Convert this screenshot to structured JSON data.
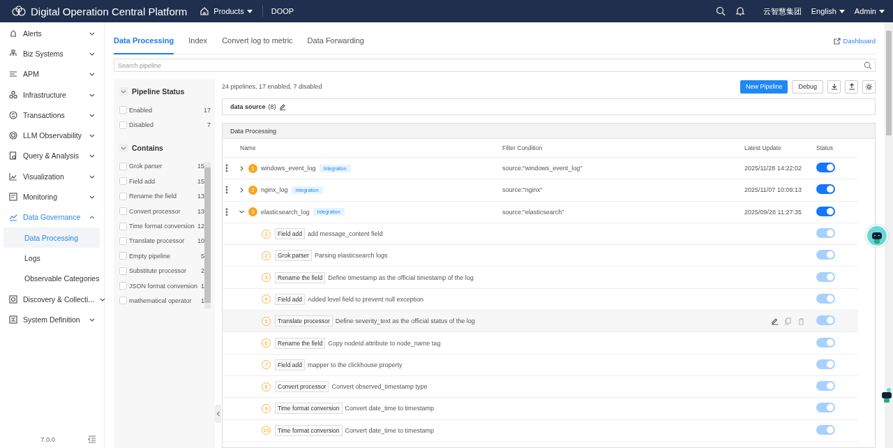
{
  "header": {
    "title": "Digital Operation Central Platform",
    "products": "Products",
    "app": "DOOP",
    "org": "云智慧集团",
    "language": "English",
    "user": "Admin"
  },
  "sidebar": {
    "items": [
      {
        "label": "Alerts",
        "expanded": false,
        "active": false
      },
      {
        "label": "Biz Systems",
        "expanded": false,
        "active": false
      },
      {
        "label": "APM",
        "expanded": false,
        "active": false
      },
      {
        "label": "Infrastructure",
        "expanded": false,
        "active": false
      },
      {
        "label": "Transactions",
        "expanded": false,
        "active": false
      },
      {
        "label": "LLM Observability",
        "expanded": false,
        "active": false
      },
      {
        "label": "Query & Analysis",
        "expanded": false,
        "active": false
      },
      {
        "label": "Visualization",
        "expanded": false,
        "active": false
      },
      {
        "label": "Monitoring",
        "expanded": false,
        "active": false
      },
      {
        "label": "Data Governance",
        "expanded": true,
        "active": true,
        "children": [
          {
            "label": "Data Processing",
            "selected": true
          },
          {
            "label": "Logs",
            "selected": false
          },
          {
            "label": "Observable Categories",
            "selected": false
          }
        ]
      },
      {
        "label": "Discovery & Collecti...",
        "expanded": false,
        "active": false
      },
      {
        "label": "System Definition",
        "expanded": false,
        "active": false
      }
    ],
    "version": "7.0.0"
  },
  "tabs": [
    {
      "label": "Data Processing",
      "selected": true
    },
    {
      "label": "Index",
      "selected": false
    },
    {
      "label": "Convert log to metric",
      "selected": false
    },
    {
      "label": "Data Forwarding",
      "selected": false
    }
  ],
  "dashboard_link": "Dashboard",
  "search": {
    "placeholder": "Search pipeline"
  },
  "filters": [
    {
      "title": "Pipeline Status",
      "expanded": true,
      "items": [
        {
          "label": "Enabled",
          "count": "17",
          "checked": false
        },
        {
          "label": "Disabled",
          "count": "7",
          "checked": false
        }
      ]
    },
    {
      "title": "Contains",
      "expanded": true,
      "items": [
        {
          "label": "Grok parser",
          "count": "15",
          "checked": false
        },
        {
          "label": "Field add",
          "count": "15",
          "checked": false
        },
        {
          "label": "Rename the field",
          "count": "13",
          "checked": false
        },
        {
          "label": "Convert processor",
          "count": "13",
          "checked": false
        },
        {
          "label": "Time format conversion",
          "count": "12",
          "checked": false
        },
        {
          "label": "Translate processor",
          "count": "10",
          "checked": false
        },
        {
          "label": "Empty pipeline",
          "count": "5",
          "checked": false
        },
        {
          "label": "Substitute processor",
          "count": "2",
          "checked": false
        },
        {
          "label": "JSON format conversion",
          "count": "1",
          "checked": false
        },
        {
          "label": "mathematical operator",
          "count": "1",
          "checked": false
        }
      ]
    }
  ],
  "summary": "24 pipelines, 17 enabled, 7 disabled",
  "buttons": {
    "new": "New Pipeline",
    "debug": "Debug"
  },
  "data_source": {
    "label": "data source",
    "count": "(8)"
  },
  "panel_title": "Data Processing",
  "table": {
    "columns": [
      "Name",
      "Filter Condition",
      "Latest Update",
      "Status"
    ],
    "rows": [
      {
        "number": "1",
        "name": "windows_event_log",
        "tag": "Integration",
        "filter": "source:\"windows_event_log\"",
        "updated": "2025/11/28 14:22:02",
        "on": true,
        "expanded": false
      },
      {
        "number": "2",
        "name": "nginx_log",
        "tag": "Integration",
        "filter": "source:\"nginx\"",
        "updated": "2025/11/07 10:09:13",
        "on": true,
        "expanded": false
      },
      {
        "number": "3",
        "name": "elasticsearch_log",
        "tag": "Integration",
        "filter": "source:\"elasticsearch\"",
        "updated": "2025/09/28 11:27:35",
        "on": true,
        "expanded": true,
        "children": [
          {
            "number": "1",
            "processor": "Field add",
            "description": "add message_content field",
            "on": true,
            "disabled": true,
            "highlighted": false
          },
          {
            "number": "2",
            "processor": "Grok parser",
            "description": "Parsing elasticsearch logs",
            "on": true,
            "disabled": true,
            "highlighted": false
          },
          {
            "number": "3",
            "processor": "Rename the field",
            "description": "Define timestamp as the official timestamp of the log",
            "on": true,
            "disabled": true,
            "highlighted": false
          },
          {
            "number": "4",
            "processor": "Field add",
            "description": "Added level field to prevent null exception",
            "on": true,
            "disabled": true,
            "highlighted": false
          },
          {
            "number": "5",
            "processor": "Translate processor",
            "description": "Define severity_text as the official status of the log",
            "on": true,
            "disabled": true,
            "highlighted": true
          },
          {
            "number": "6",
            "processor": "Rename the field",
            "description": "Copy nodeId attribute to node_name tag",
            "on": true,
            "disabled": true,
            "highlighted": false
          },
          {
            "number": "7",
            "processor": "Field add",
            "description": "mapper to the clickhouse property",
            "on": true,
            "disabled": true,
            "highlighted": false
          },
          {
            "number": "8",
            "processor": "Convert processor",
            "description": "Convert observed_timestamp type",
            "on": true,
            "disabled": true,
            "highlighted": false
          },
          {
            "number": "9",
            "processor": "Time format conversion",
            "description": "Convert date_time to timestamp",
            "on": true,
            "disabled": true,
            "highlighted": false
          },
          {
            "number": "10",
            "processor": "Time format conversion",
            "description": "Convert date_time to timestamp",
            "on": true,
            "disabled": true,
            "highlighted": false
          }
        ]
      }
    ]
  }
}
